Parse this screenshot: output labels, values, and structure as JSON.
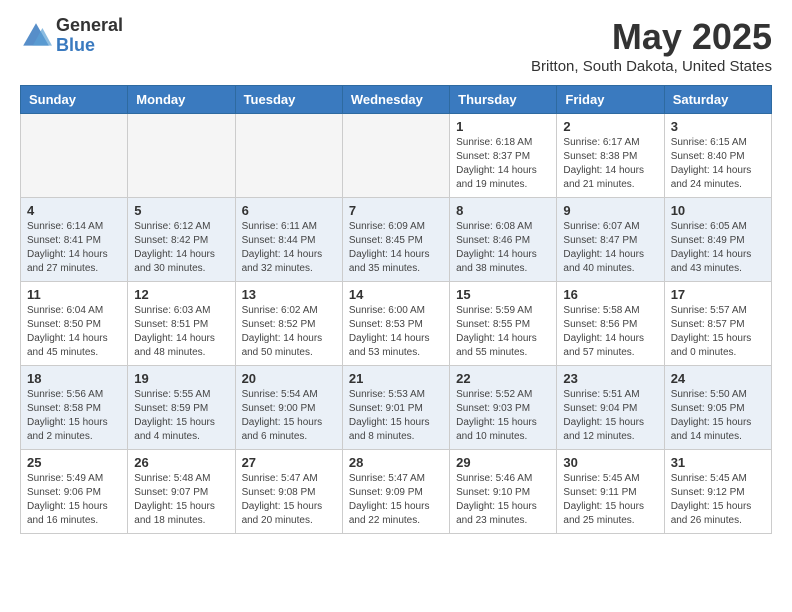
{
  "logo": {
    "general": "General",
    "blue": "Blue"
  },
  "header": {
    "title": "May 2025",
    "subtitle": "Britton, South Dakota, United States"
  },
  "weekdays": [
    "Sunday",
    "Monday",
    "Tuesday",
    "Wednesday",
    "Thursday",
    "Friday",
    "Saturday"
  ],
  "weeks": [
    [
      {
        "day": "",
        "info": ""
      },
      {
        "day": "",
        "info": ""
      },
      {
        "day": "",
        "info": ""
      },
      {
        "day": "",
        "info": ""
      },
      {
        "day": "1",
        "info": "Sunrise: 6:18 AM\nSunset: 8:37 PM\nDaylight: 14 hours and 19 minutes."
      },
      {
        "day": "2",
        "info": "Sunrise: 6:17 AM\nSunset: 8:38 PM\nDaylight: 14 hours and 21 minutes."
      },
      {
        "day": "3",
        "info": "Sunrise: 6:15 AM\nSunset: 8:40 PM\nDaylight: 14 hours and 24 minutes."
      }
    ],
    [
      {
        "day": "4",
        "info": "Sunrise: 6:14 AM\nSunset: 8:41 PM\nDaylight: 14 hours and 27 minutes."
      },
      {
        "day": "5",
        "info": "Sunrise: 6:12 AM\nSunset: 8:42 PM\nDaylight: 14 hours and 30 minutes."
      },
      {
        "day": "6",
        "info": "Sunrise: 6:11 AM\nSunset: 8:44 PM\nDaylight: 14 hours and 32 minutes."
      },
      {
        "day": "7",
        "info": "Sunrise: 6:09 AM\nSunset: 8:45 PM\nDaylight: 14 hours and 35 minutes."
      },
      {
        "day": "8",
        "info": "Sunrise: 6:08 AM\nSunset: 8:46 PM\nDaylight: 14 hours and 38 minutes."
      },
      {
        "day": "9",
        "info": "Sunrise: 6:07 AM\nSunset: 8:47 PM\nDaylight: 14 hours and 40 minutes."
      },
      {
        "day": "10",
        "info": "Sunrise: 6:05 AM\nSunset: 8:49 PM\nDaylight: 14 hours and 43 minutes."
      }
    ],
    [
      {
        "day": "11",
        "info": "Sunrise: 6:04 AM\nSunset: 8:50 PM\nDaylight: 14 hours and 45 minutes."
      },
      {
        "day": "12",
        "info": "Sunrise: 6:03 AM\nSunset: 8:51 PM\nDaylight: 14 hours and 48 minutes."
      },
      {
        "day": "13",
        "info": "Sunrise: 6:02 AM\nSunset: 8:52 PM\nDaylight: 14 hours and 50 minutes."
      },
      {
        "day": "14",
        "info": "Sunrise: 6:00 AM\nSunset: 8:53 PM\nDaylight: 14 hours and 53 minutes."
      },
      {
        "day": "15",
        "info": "Sunrise: 5:59 AM\nSunset: 8:55 PM\nDaylight: 14 hours and 55 minutes."
      },
      {
        "day": "16",
        "info": "Sunrise: 5:58 AM\nSunset: 8:56 PM\nDaylight: 14 hours and 57 minutes."
      },
      {
        "day": "17",
        "info": "Sunrise: 5:57 AM\nSunset: 8:57 PM\nDaylight: 15 hours and 0 minutes."
      }
    ],
    [
      {
        "day": "18",
        "info": "Sunrise: 5:56 AM\nSunset: 8:58 PM\nDaylight: 15 hours and 2 minutes."
      },
      {
        "day": "19",
        "info": "Sunrise: 5:55 AM\nSunset: 8:59 PM\nDaylight: 15 hours and 4 minutes."
      },
      {
        "day": "20",
        "info": "Sunrise: 5:54 AM\nSunset: 9:00 PM\nDaylight: 15 hours and 6 minutes."
      },
      {
        "day": "21",
        "info": "Sunrise: 5:53 AM\nSunset: 9:01 PM\nDaylight: 15 hours and 8 minutes."
      },
      {
        "day": "22",
        "info": "Sunrise: 5:52 AM\nSunset: 9:03 PM\nDaylight: 15 hours and 10 minutes."
      },
      {
        "day": "23",
        "info": "Sunrise: 5:51 AM\nSunset: 9:04 PM\nDaylight: 15 hours and 12 minutes."
      },
      {
        "day": "24",
        "info": "Sunrise: 5:50 AM\nSunset: 9:05 PM\nDaylight: 15 hours and 14 minutes."
      }
    ],
    [
      {
        "day": "25",
        "info": "Sunrise: 5:49 AM\nSunset: 9:06 PM\nDaylight: 15 hours and 16 minutes."
      },
      {
        "day": "26",
        "info": "Sunrise: 5:48 AM\nSunset: 9:07 PM\nDaylight: 15 hours and 18 minutes."
      },
      {
        "day": "27",
        "info": "Sunrise: 5:47 AM\nSunset: 9:08 PM\nDaylight: 15 hours and 20 minutes."
      },
      {
        "day": "28",
        "info": "Sunrise: 5:47 AM\nSunset: 9:09 PM\nDaylight: 15 hours and 22 minutes."
      },
      {
        "day": "29",
        "info": "Sunrise: 5:46 AM\nSunset: 9:10 PM\nDaylight: 15 hours and 23 minutes."
      },
      {
        "day": "30",
        "info": "Sunrise: 5:45 AM\nSunset: 9:11 PM\nDaylight: 15 hours and 25 minutes."
      },
      {
        "day": "31",
        "info": "Sunrise: 5:45 AM\nSunset: 9:12 PM\nDaylight: 15 hours and 26 minutes."
      }
    ]
  ]
}
